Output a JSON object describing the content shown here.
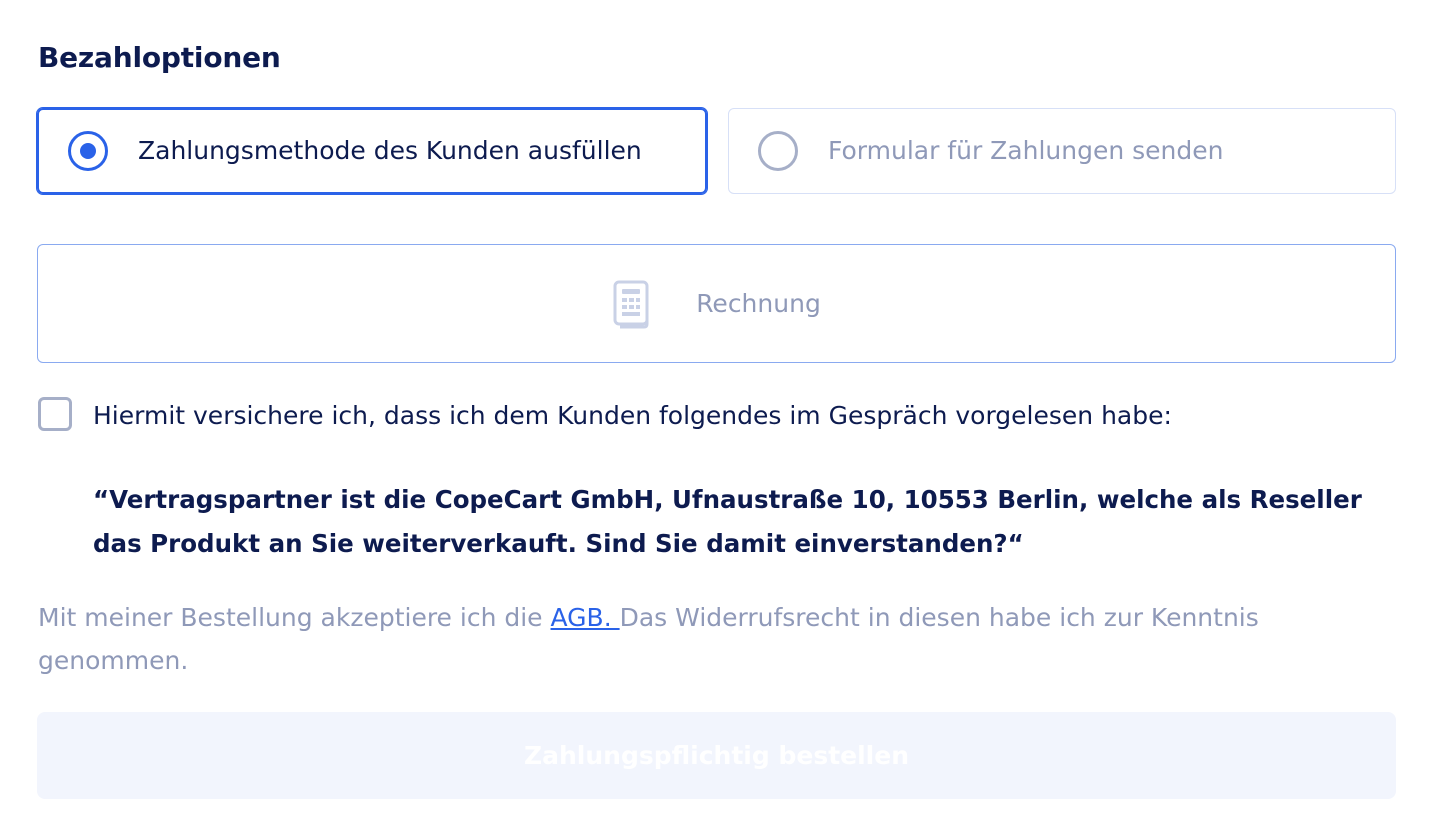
{
  "payment_options": {
    "title": "Bezahloptionen",
    "options": [
      {
        "label": "Zahlungsmethode des Kunden ausfüllen",
        "selected": true
      },
      {
        "label": "Formular für Zahlungen senden",
        "selected": false
      }
    ]
  },
  "payment_method": {
    "label": "Rechnung",
    "icon": "invoice-icon"
  },
  "confirmation": {
    "checked": false,
    "label": "Hiermit versichere ich, dass ich dem Kunden folgendes im Gespräch vorgelesen habe:",
    "quote": "“Vertragspartner ist die CopeCart GmbH, Ufnaustraße 10, 10553 Berlin, welche als Reseller das Produkt an Sie weiterverkauft. Sind Sie damit einverstanden?“"
  },
  "terms": {
    "prefix": "Mit meiner Bestellung akzeptiere ich die ",
    "link_text": "AGB. ",
    "suffix": "Das Widerrufsrecht in diesen habe ich zur Kenntnis genommen."
  },
  "submit": {
    "label": "Zahlungspflichtig bestellen",
    "disabled": true
  },
  "colors": {
    "accent": "#2a62e8",
    "text_dark": "#0d1b4f",
    "text_muted": "#8f99b8",
    "disabled_button_bg": "#f2f5fd"
  }
}
